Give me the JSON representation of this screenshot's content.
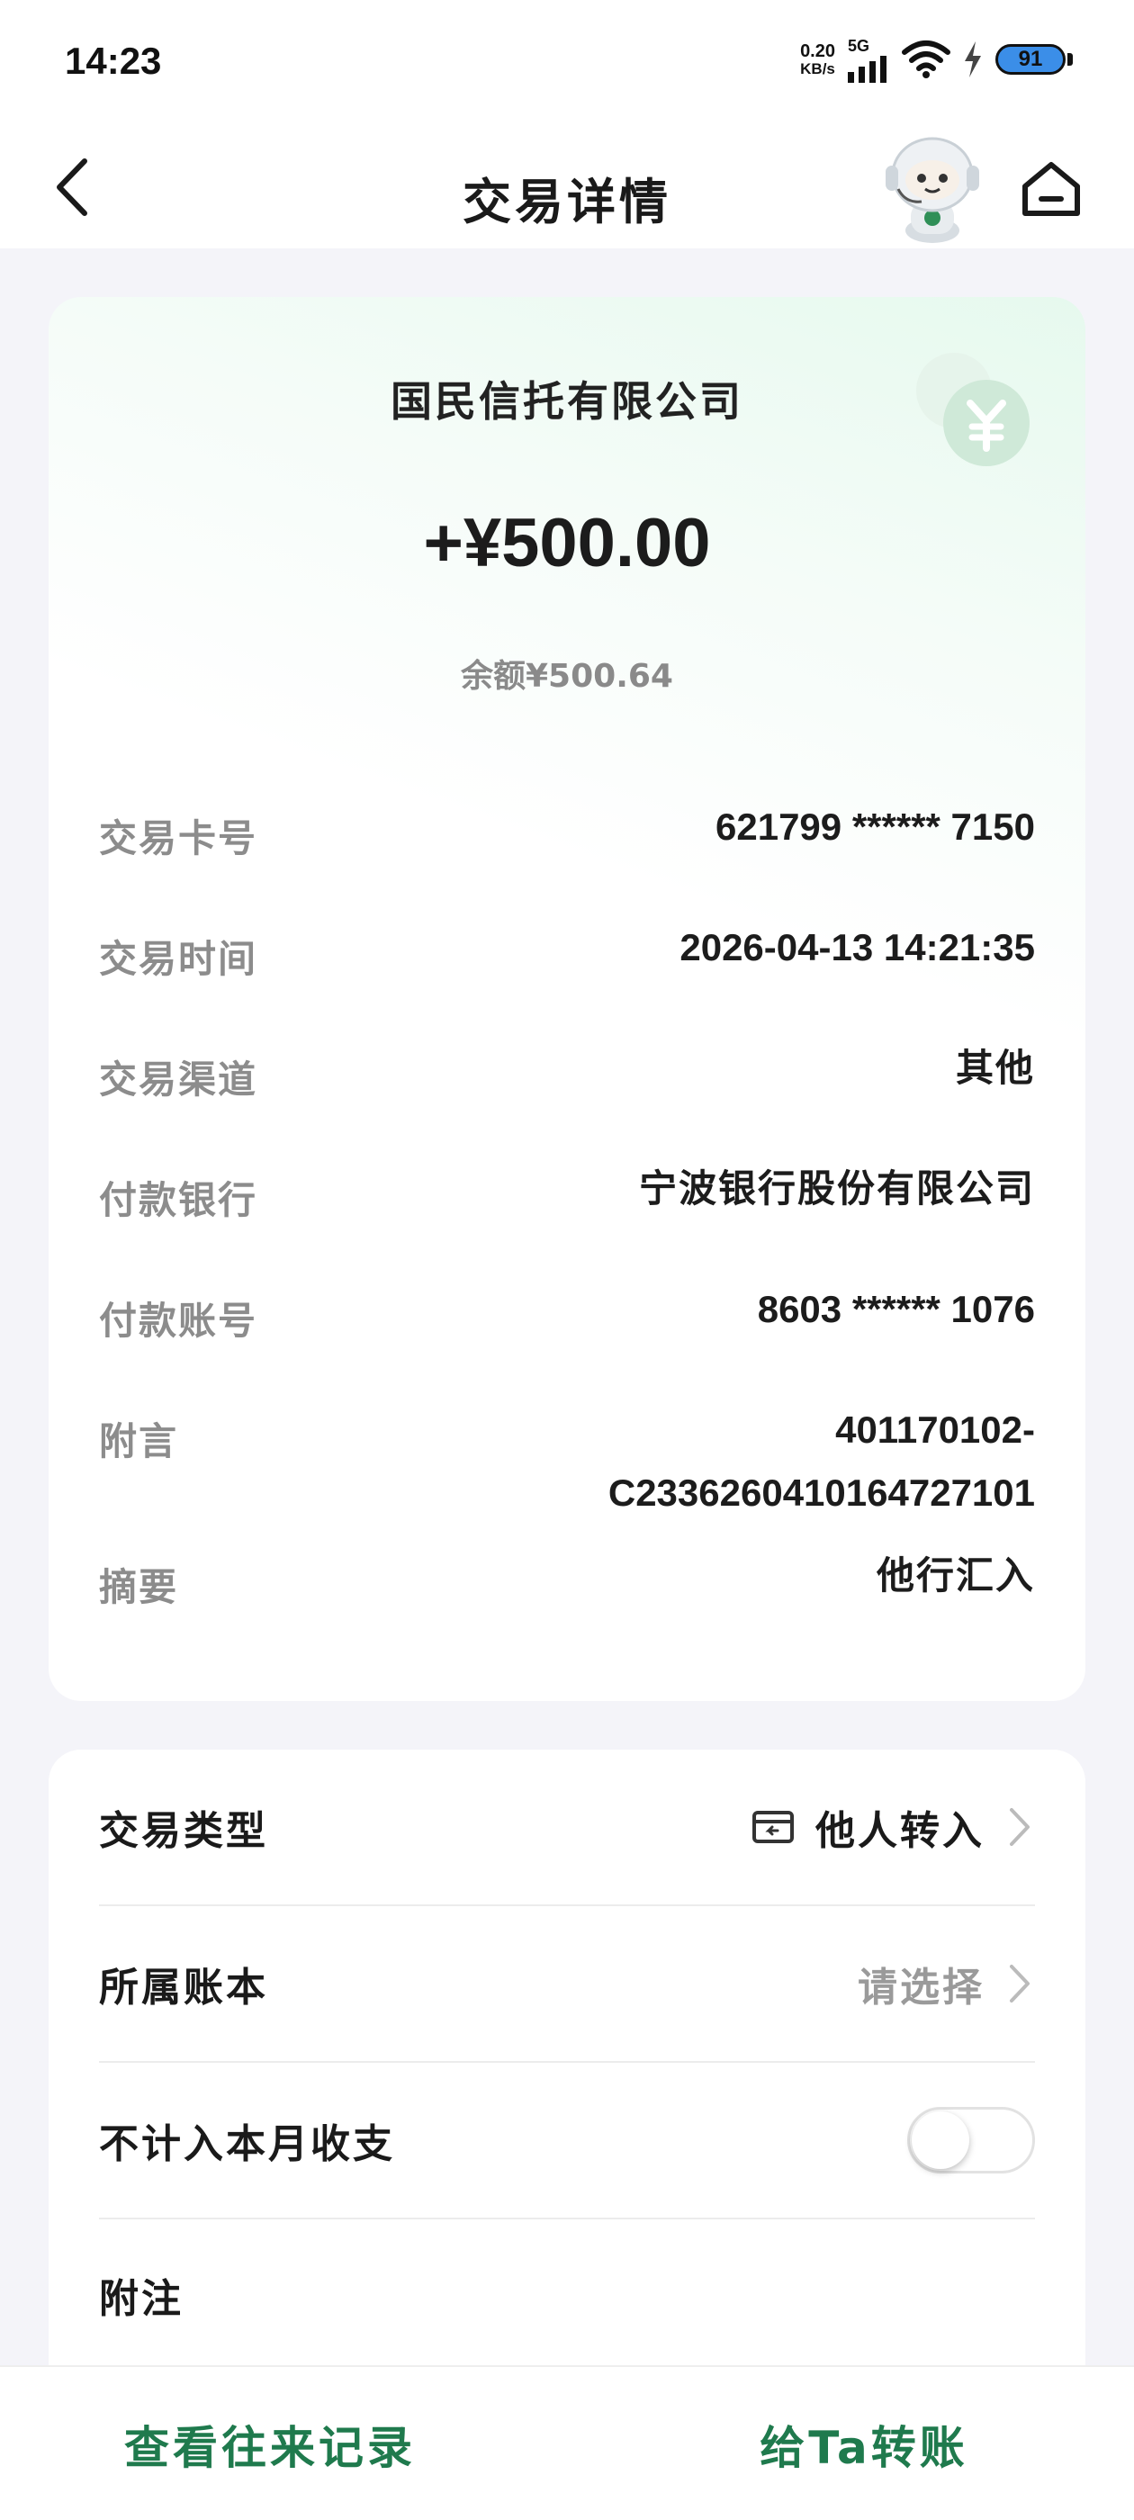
{
  "status_bar": {
    "time": "14:23",
    "net_speed_value": "0.20",
    "net_speed_unit": "KB/s",
    "network": "5G",
    "battery": "91"
  },
  "header": {
    "title": "交易详情",
    "icons": [
      "back-arrow-icon",
      "mascot-icon",
      "home-icon"
    ]
  },
  "summary": {
    "payee": "国民信托有限公司",
    "amount": "+¥500.00",
    "balance": "余额¥500.64",
    "badge_icon": "yuan-coin-icon",
    "accent_color": "#1f7a4d"
  },
  "details": [
    {
      "label": "交易卡号",
      "value": "621799  ******  7150"
    },
    {
      "label": "交易时间",
      "value": "2026-04-13  14:21:35"
    },
    {
      "label": "交易渠道",
      "value": "其他"
    },
    {
      "label": "付款银行",
      "value": "宁波银行股份有限公司"
    },
    {
      "label": "付款账号",
      "value": "8603  ******  1076"
    },
    {
      "label": "附言",
      "value_line1": "401170102-",
      "value_line2": "C23362604101647271​01"
    },
    {
      "label": "摘要",
      "value": "他行汇入"
    }
  ],
  "settings": {
    "type_label": "交易类型",
    "type_value": "他人转入",
    "book_label": "所属账本",
    "book_value": "请选择",
    "exclude_label": "不计入本月收支",
    "exclude_on": false,
    "note_label": "附注"
  },
  "bottom": {
    "history_label": "查看往来记录",
    "transfer_label": "给Ta转账"
  }
}
